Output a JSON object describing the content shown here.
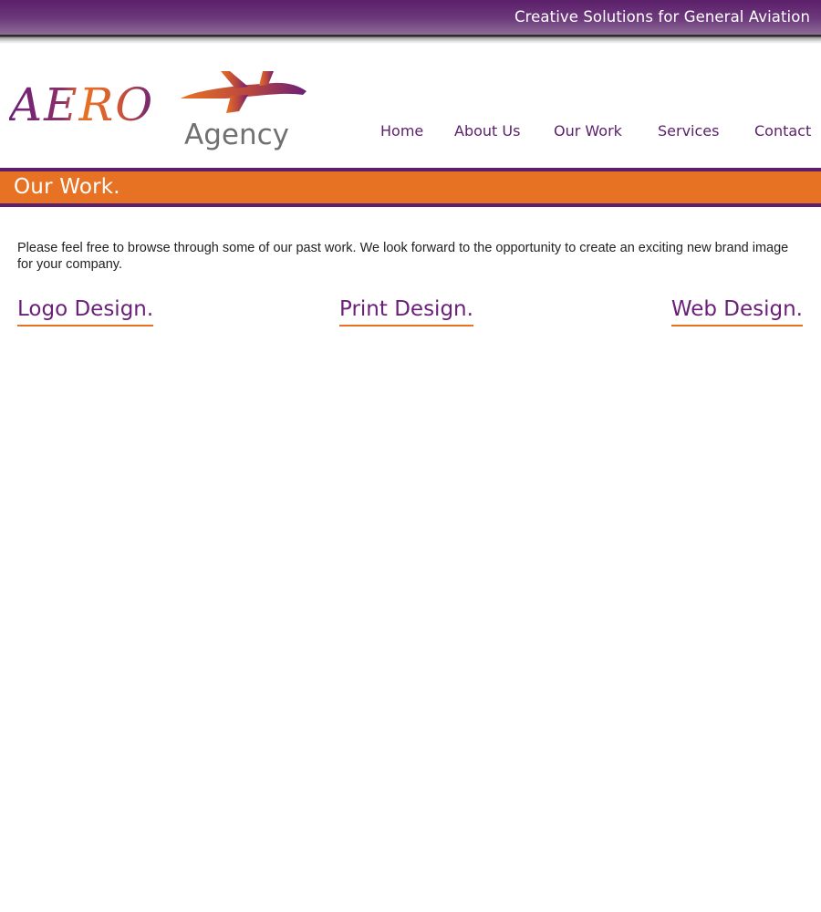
{
  "header": {
    "tagline": "Creative Solutions for General Aviation"
  },
  "logo": {
    "word_aero": "AERO",
    "word_agency": "Agency",
    "colors": {
      "purple": "#6a1f78",
      "orange": "#e87224",
      "gray": "#707070"
    }
  },
  "nav": {
    "items": [
      {
        "label": "Home"
      },
      {
        "label": "About Us"
      },
      {
        "label": "Our Work"
      },
      {
        "label": "Services"
      },
      {
        "label": "Contact"
      }
    ]
  },
  "banner": {
    "title": "Our Work."
  },
  "main": {
    "intro": "Please feel free to browse through some of our past work. We look forward to the opportunity to create an exciting new brand image for your company.",
    "categories": [
      {
        "label": "Logo Design."
      },
      {
        "label": "Print Design."
      },
      {
        "label": "Web Design."
      }
    ]
  },
  "colors": {
    "brand_purple": "#5c1f6b",
    "brand_orange": "#e87224",
    "background": "#ffffff"
  }
}
